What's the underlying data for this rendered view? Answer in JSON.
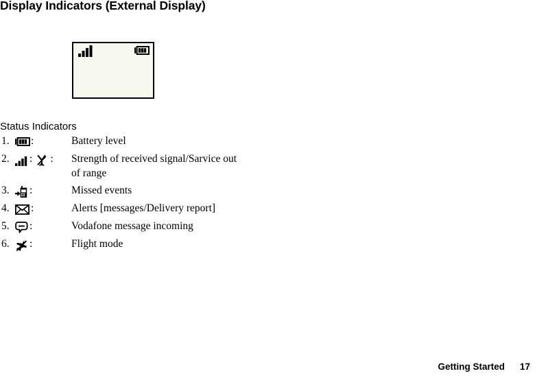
{
  "page": {
    "title": "Display Indicators (External Display)",
    "section_heading": "Status Indicators"
  },
  "display_mock": {
    "signal_icon": "signal-bars-icon",
    "battery_icon": "battery-icon",
    "screen_color": "#f7f9ef",
    "border_color": "#000000"
  },
  "indicators": [
    {
      "number": "1.",
      "icons": [
        "battery-icon"
      ],
      "separator": ":",
      "description": "Battery level",
      "description_line2": ""
    },
    {
      "number": "2.",
      "icons": [
        "signal-bars-icon",
        "no-service-icon"
      ],
      "separator": ":",
      "description": "Strength of received signal/Sarvice out",
      "description_line2": "of range"
    },
    {
      "number": "3.",
      "icons": [
        "missed-events-phone-icon"
      ],
      "separator": ":",
      "description": "Missed events",
      "description_line2": ""
    },
    {
      "number": "4.",
      "icons": [
        "envelope-icon"
      ],
      "separator": ":",
      "description": "Alerts [messages/Delivery report]",
      "description_line2": ""
    },
    {
      "number": "5.",
      "icons": [
        "speech-bubble-icon"
      ],
      "separator": ":",
      "description": "Vodafone message incoming",
      "description_line2": ""
    },
    {
      "number": "6.",
      "icons": [
        "flight-mode-icon"
      ],
      "separator": ":",
      "description": "Flight mode",
      "description_line2": ""
    }
  ],
  "footer": {
    "chapter": "Getting Started",
    "page_number": "17"
  }
}
